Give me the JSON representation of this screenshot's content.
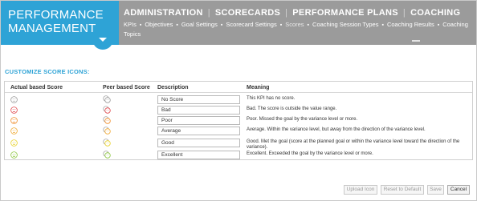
{
  "brand": {
    "line1": "PERFORMANCE",
    "line2": "MANAGEMENT"
  },
  "topnav": {
    "items": [
      "ADMINISTRATION",
      "SCORECARDS",
      "PERFORMANCE PLANS",
      "COACHING"
    ]
  },
  "subnav": {
    "items": [
      "KPIs",
      "Objectives",
      "Goal Settings",
      "Scorecard Settings",
      "Scores",
      "Coaching Session Types",
      "Coaching Results",
      "Coaching Topics"
    ],
    "current": "Scores"
  },
  "section": {
    "title": "CUSTOMIZE SCORE ICONS:"
  },
  "table": {
    "headers": {
      "actual": "Actual based Score",
      "peer": "Peer based Score",
      "description": "Description",
      "meaning": "Meaning"
    },
    "rows": [
      {
        "description": "No Score",
        "meaning": "This KPI has no score.",
        "color": "#9a9a9a"
      },
      {
        "description": "Bad",
        "meaning": "Bad. The score is outside the value range.",
        "color": "#e0474c"
      },
      {
        "description": "Poor",
        "meaning": "Poor. Missed the goal by the variance level or more.",
        "color": "#f08a24"
      },
      {
        "description": "Average",
        "meaning": "Average. Within the variance level, but away from the direction of the variance level.",
        "color": "#f0a830"
      },
      {
        "description": "Good",
        "meaning": "Good. Met the goal (score at the planned goal or within the variance level toward the direction of the variance).",
        "color": "#e8d22a"
      },
      {
        "description": "Excellent",
        "meaning": "Excellent. Exceeded the goal by the variance level or more.",
        "color": "#8cc63f"
      }
    ]
  },
  "buttons": {
    "upload": "Upload Icon",
    "reset": "Reset to Default",
    "save": "Save",
    "cancel": "Cancel"
  },
  "colors": {
    "brand": "#2ea3d6",
    "nav": "#9b9b9b"
  }
}
